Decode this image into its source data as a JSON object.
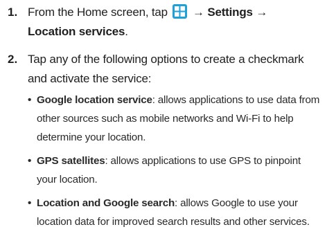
{
  "steps": [
    {
      "number": "1.",
      "before_icon": "From the Home screen, tap",
      "icon": "apps-grid-icon",
      "arrow1": "→",
      "settings": "Settings",
      "arrow2": "→",
      "location_services": "Location services",
      "end": "."
    },
    {
      "number": "2.",
      "text": "Tap any of the following options to create a checkmark and activate the service:"
    }
  ],
  "options": [
    {
      "term": "Google location service",
      "description": ": allows applications to use data from other sources such as mobile networks and Wi-Fi to help determine your location."
    },
    {
      "term": "GPS satellites",
      "description": ": allows applications to use GPS to pinpoint your location."
    },
    {
      "term": "Location and Google search",
      "description": ": allows Google to use your location data for improved search results and other services."
    }
  ],
  "colors": {
    "icon_bg": "#1ea0d8",
    "text": "#1f1f1f"
  }
}
